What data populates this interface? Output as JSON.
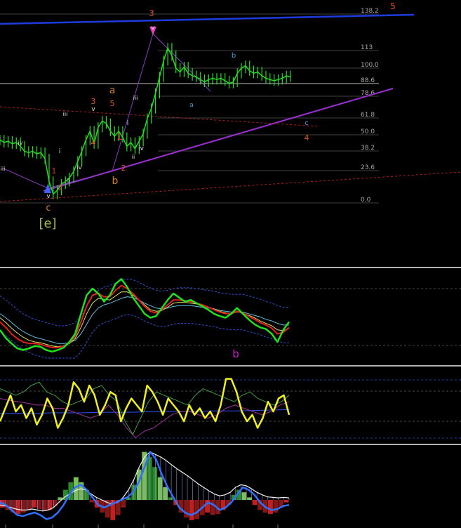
{
  "chart_data": {
    "type": "line",
    "main": {
      "fib_levels": [
        "138.2",
        "113",
        "100.0",
        "88.6",
        "78.6",
        "61.8",
        "50.0",
        "38.2",
        "23.6",
        "0.0"
      ],
      "wave_labels": [
        {
          "text": "3",
          "color": "#e05020"
        },
        {
          "text": "5",
          "color": "#e05020"
        },
        {
          "text": "v",
          "color": "#e0e0e0"
        },
        {
          "text": "b",
          "color": "#3aa0e0"
        },
        {
          "text": "a",
          "color": "#3aa0e0"
        },
        {
          "text": "c",
          "color": "#3aa0e0"
        },
        {
          "text": "4",
          "color": "#e05020"
        },
        {
          "text": "a",
          "color": "#d08020"
        },
        {
          "text": "5",
          "color": "#e05020"
        },
        {
          "text": "3",
          "color": "#e05020"
        },
        {
          "text": "v",
          "color": "#e0e0e0"
        },
        {
          "text": "iii",
          "color": "#e0e0e0"
        },
        {
          "text": "iii",
          "color": "#e0e0e0"
        },
        {
          "text": "4",
          "color": "#e05020"
        },
        {
          "text": "1",
          "color": "#e03030"
        },
        {
          "text": "i",
          "color": "#e0e0e0"
        },
        {
          "text": "iv",
          "color": "#e0e0e0"
        },
        {
          "text": "ii",
          "color": "#e0e0e0"
        },
        {
          "text": "2",
          "color": "#e05020"
        },
        {
          "text": "b",
          "color": "#d08020"
        },
        {
          "text": "iv",
          "color": "#e0e0e0"
        },
        {
          "text": "iii",
          "color": "#e0e0e0"
        },
        {
          "text": "i",
          "color": "#e0e0e0"
        },
        {
          "text": "iv",
          "color": "#e0e0e0"
        },
        {
          "text": "ii",
          "color": "#e0e0e0"
        },
        {
          "text": "1",
          "color": "#e03030"
        },
        {
          "text": "2",
          "color": "#e03030"
        },
        {
          "text": "v",
          "color": "#e0e0e0"
        },
        {
          "text": "c",
          "color": "#d08020"
        },
        {
          "text": "[e]",
          "color": "#a0c040"
        }
      ],
      "price_close": [
        0.45,
        0.43,
        0.44,
        0.42,
        0.43,
        0.4,
        0.36,
        0.35,
        0.36,
        0.34,
        0.35,
        0.3,
        0.12,
        0.02,
        0.05,
        0.1,
        0.12,
        0.15,
        0.2,
        0.28,
        0.36,
        0.45,
        0.52,
        0.42,
        0.55,
        0.6,
        0.58,
        0.52,
        0.48,
        0.52,
        0.47,
        0.4,
        0.43,
        0.38,
        0.44,
        0.5,
        0.62,
        0.7,
        0.82,
        0.95,
        1.08,
        1.18,
        1.12,
        1.02,
        0.99,
        1.03,
        0.98,
        0.96,
        0.95,
        0.93,
        0.91,
        0.93,
        0.94,
        0.93,
        0.94,
        0.92,
        0.9,
        0.91,
        0.98,
        1.02,
        1.04,
        1.0,
        0.98,
        0.99,
        0.96,
        0.94,
        0.93,
        0.92,
        0.93,
        0.94,
        0.96,
        0.95
      ],
      "ylim": [
        -0.05,
        1.45
      ]
    },
    "panel2": {
      "annotation": "b",
      "green": [
        0.35,
        0.25,
        0.18,
        0.12,
        0.1,
        0.12,
        0.15,
        0.14,
        0.1,
        0.08,
        0.1,
        0.13,
        0.2,
        0.3,
        0.55,
        0.78,
        0.86,
        0.8,
        0.7,
        0.78,
        0.92,
        0.98,
        0.88,
        0.75,
        0.65,
        0.55,
        0.5,
        0.52,
        0.62,
        0.72,
        0.8,
        0.75,
        0.7,
        0.72,
        0.68,
        0.64,
        0.6,
        0.55,
        0.52,
        0.5,
        0.55,
        0.62,
        0.55,
        0.48,
        0.42,
        0.38,
        0.36,
        0.3,
        0.2,
        0.35,
        0.45
      ],
      "red": [
        0.45,
        0.38,
        0.3,
        0.24,
        0.2,
        0.18,
        0.18,
        0.17,
        0.15,
        0.13,
        0.13,
        0.15,
        0.19,
        0.27,
        0.45,
        0.65,
        0.78,
        0.8,
        0.76,
        0.76,
        0.84,
        0.9,
        0.86,
        0.8,
        0.72,
        0.64,
        0.58,
        0.56,
        0.6,
        0.66,
        0.72,
        0.72,
        0.71,
        0.7,
        0.68,
        0.66,
        0.63,
        0.6,
        0.57,
        0.55,
        0.55,
        0.58,
        0.56,
        0.52,
        0.48,
        0.44,
        0.41,
        0.37,
        0.3,
        0.32,
        0.38
      ],
      "yellow": [
        0.5,
        0.44,
        0.37,
        0.31,
        0.26,
        0.22,
        0.2,
        0.19,
        0.17,
        0.15,
        0.14,
        0.15,
        0.18,
        0.24,
        0.38,
        0.55,
        0.68,
        0.74,
        0.73,
        0.72,
        0.77,
        0.82,
        0.82,
        0.78,
        0.72,
        0.66,
        0.6,
        0.58,
        0.59,
        0.63,
        0.68,
        0.69,
        0.69,
        0.68,
        0.67,
        0.65,
        0.63,
        0.61,
        0.58,
        0.56,
        0.55,
        0.57,
        0.56,
        0.53,
        0.5,
        0.46,
        0.43,
        0.4,
        0.35,
        0.34,
        0.37
      ],
      "cyan": [
        0.55,
        0.5,
        0.44,
        0.38,
        0.33,
        0.29,
        0.26,
        0.24,
        0.22,
        0.2,
        0.18,
        0.18,
        0.19,
        0.22,
        0.3,
        0.42,
        0.54,
        0.62,
        0.66,
        0.68,
        0.71,
        0.74,
        0.76,
        0.75,
        0.72,
        0.68,
        0.65,
        0.62,
        0.61,
        0.62,
        0.64,
        0.65,
        0.65,
        0.65,
        0.64,
        0.63,
        0.62,
        0.61,
        0.59,
        0.58,
        0.57,
        0.57,
        0.57,
        0.55,
        0.53,
        0.51,
        0.48,
        0.46,
        0.43,
        0.41,
        0.41
      ],
      "ylim": [
        0,
        1
      ]
    },
    "panel3": {
      "yellow": [
        0.3,
        0.5,
        0.7,
        0.45,
        0.55,
        0.35,
        0.5,
        0.25,
        0.4,
        0.65,
        0.5,
        0.2,
        0.35,
        0.55,
        0.9,
        0.8,
        0.6,
        0.85,
        0.7,
        0.4,
        0.55,
        0.75,
        0.7,
        0.3,
        0.5,
        0.65,
        0.55,
        0.45,
        0.85,
        0.75,
        0.6,
        0.4,
        0.65,
        0.55,
        0.45,
        0.3,
        0.55,
        0.4,
        0.5,
        0.35,
        0.45,
        0.3,
        0.55,
        0.95,
        0.95,
        0.75,
        0.45,
        0.3,
        0.4,
        0.2,
        0.35,
        0.6,
        0.45,
        0.65,
        0.7,
        0.4
      ],
      "green": [
        0.8,
        0.75,
        0.7,
        0.75,
        0.85,
        0.9,
        0.75,
        0.7,
        0.6,
        0.55,
        0.6,
        0.65,
        0.8,
        0.85,
        0.7,
        0.6,
        0.3,
        0.1,
        0.35,
        0.6,
        0.75,
        0.7,
        0.65,
        0.6,
        0.55,
        0.7,
        0.8,
        0.75,
        0.7,
        0.65,
        0.6,
        0.7,
        0.75,
        0.65,
        0.6,
        0.55,
        0.6,
        0.7
      ],
      "purple": [
        0.65,
        0.62,
        0.6,
        0.58,
        0.55,
        0.55,
        0.5,
        0.5,
        0.45,
        0.4,
        0.35,
        0.4,
        0.55,
        0.4,
        0.2,
        0.05,
        0.15,
        0.2,
        0.3,
        0.4,
        0.45,
        0.45,
        0.4,
        0.35,
        0.4,
        0.5,
        0.55,
        0.5,
        0.45,
        0.4,
        0.45,
        0.55,
        0.6
      ],
      "blue": [
        0.42,
        0.42,
        0.43,
        0.43,
        0.44,
        0.44,
        0.45,
        0.45,
        0.46,
        0.46,
        0.47,
        0.48
      ],
      "ylim": [
        0,
        1
      ]
    },
    "panel4": {
      "hist": [
        -0.15,
        -0.2,
        -0.25,
        -0.28,
        -0.25,
        -0.2,
        -0.15,
        -0.18,
        -0.22,
        -0.2,
        -0.12,
        0.05,
        0.2,
        0.35,
        0.45,
        0.35,
        0.2,
        -0.05,
        -0.15,
        -0.25,
        -0.35,
        -0.4,
        -0.3,
        -0.15,
        0.05,
        0.3,
        0.6,
        0.95,
        0.85,
        0.65,
        0.45,
        0.25,
        0.05,
        -0.1,
        -0.25,
        -0.35,
        -0.4,
        -0.38,
        -0.3,
        -0.25,
        -0.3,
        -0.28,
        -0.2,
        -0.1,
        0.1,
        0.2,
        0.15,
        0.05,
        -0.1,
        -0.2,
        -0.25,
        -0.28,
        -0.25,
        -0.15,
        -0.05
      ],
      "white": [
        -0.1,
        -0.12,
        -0.15,
        -0.18,
        -0.2,
        -0.2,
        -0.18,
        -0.2,
        -0.22,
        -0.2,
        -0.15,
        -0.05,
        0.05,
        0.12,
        0.18,
        0.22,
        0.2,
        0.12,
        0.05,
        0.0,
        -0.05,
        -0.08,
        -0.05,
        0.05,
        0.2,
        0.4,
        0.65,
        0.85,
        0.95,
        0.9,
        0.85,
        0.78,
        0.7,
        0.62,
        0.55,
        0.48,
        0.4,
        0.32,
        0.25,
        0.18,
        0.12,
        0.08,
        0.1,
        0.15,
        0.25,
        0.3,
        0.28,
        0.22,
        0.15,
        0.1,
        0.06,
        0.05,
        0.04,
        0.05,
        0.04
      ],
      "blue": [
        -0.05,
        -0.1,
        -0.2,
        -0.3,
        -0.32,
        -0.28,
        -0.25,
        -0.3,
        -0.38,
        -0.35,
        -0.25,
        -0.1,
        0.1,
        0.25,
        0.3,
        0.2,
        0.05,
        -0.1,
        -0.15,
        -0.1,
        -0.05,
        0.0,
        0.05,
        0.15,
        0.35,
        0.65,
        0.95,
        0.8,
        0.5,
        0.25,
        0.05,
        -0.15,
        -0.25,
        -0.3,
        -0.25,
        -0.15,
        -0.05,
        -0.1,
        -0.2,
        -0.15,
        -0.05,
        0.1,
        0.25,
        0.2,
        0.1,
        -0.05,
        -0.15,
        -0.2,
        -0.18,
        -0.12,
        -0.1
      ],
      "ylim": [
        -0.5,
        1.0
      ]
    },
    "colors": {
      "background": "#000000",
      "price": "#22dd22",
      "blue_trend": "#1c3ce0",
      "purple_trend": "#9a30d0",
      "red_dashed": "#b02020",
      "fib_line": "#555555",
      "fib_label": "#a8a8a8",
      "separator": "#b4b4b4",
      "annotation_b": "#d020d0"
    }
  }
}
